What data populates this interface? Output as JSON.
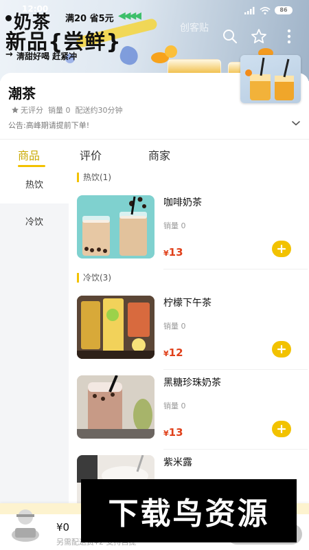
{
  "status_bar": {
    "time": "12:00",
    "battery": "86"
  },
  "banner": {
    "title_line1": "奶茶",
    "offer": "满20 省5元",
    "offer_arrows": "◀◀◀◀",
    "title_line2": "新品{尝鲜}",
    "slogan": "清甜好喝 赶紧冲",
    "watermark": "创客贴"
  },
  "store": {
    "name": "潮茶",
    "rating": "无评分",
    "sales": "销量 0",
    "delivery": "配送约30分钟",
    "notice": "公告:高峰期请提前下单!"
  },
  "tabs": [
    {
      "label": "商品",
      "active": true
    },
    {
      "label": "评价",
      "active": false
    },
    {
      "label": "商家",
      "active": false
    }
  ],
  "categories": [
    {
      "label": "热饮",
      "active": true
    },
    {
      "label": "冷饮",
      "active": false
    }
  ],
  "sections": [
    {
      "title": "热饮(1)"
    },
    {
      "title": "冷饮(3)"
    }
  ],
  "products": [
    {
      "name": "咖啡奶茶",
      "sales": "销量 0",
      "currency": "¥",
      "price": "13"
    },
    {
      "name": "柠檬下午茶",
      "sales": "销量 0",
      "currency": "¥",
      "price": "12"
    },
    {
      "name": "黑糖珍珠奶茶",
      "sales": "销量 0",
      "currency": "¥",
      "price": "13"
    },
    {
      "name": "紫米露",
      "sales": "",
      "currency": "",
      "price": ""
    }
  ],
  "cart": {
    "total": "¥0",
    "hint": "另需配送费¥2 支持自提"
  },
  "overlay_watermark": "下载鸟资源",
  "colors": {
    "accent": "#f2c200",
    "price": "#e0401a",
    "active_tab": "#c9a800"
  }
}
